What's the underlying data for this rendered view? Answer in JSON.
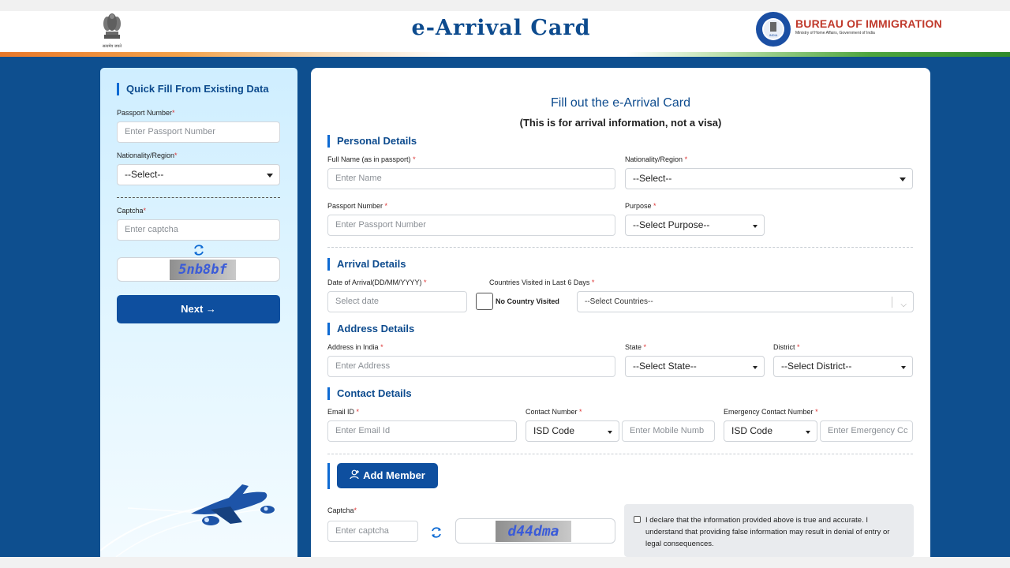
{
  "header": {
    "title": "e-Arrival Card",
    "emblem_caption": "सत्यमेव जयते",
    "bureau_name": "BUREAU OF IMMIGRATION",
    "bureau_sub": "Ministry of Home Affairs, Government of India",
    "bureau_seal_text": "INDIA"
  },
  "sidebar": {
    "title": "Quick Fill From Existing Data",
    "passport_label": "Passport Number",
    "passport_placeholder": "Enter Passport Number",
    "nationality_label": "Nationality/Region",
    "nationality_value": "--Select--",
    "captcha_label": "Captcha",
    "captcha_placeholder": "Enter captcha",
    "captcha_code": "5nb8bf",
    "next_label": "Next →",
    "required_mark": "*"
  },
  "form": {
    "heading": "Fill out the e-Arrival Card",
    "subheading": "(This is for arrival information, not a visa)",
    "required_mark": "*",
    "personal": {
      "title": "Personal Details",
      "full_name_label": "Full Name (as in passport)",
      "full_name_placeholder": "Enter Name",
      "nationality_label": "Nationality/Region",
      "nationality_value": "--Select--",
      "passport_label": "Passport Number",
      "passport_placeholder": "Enter Passport Number",
      "purpose_label": "Purpose",
      "purpose_value": "--Select Purpose--"
    },
    "arrival": {
      "title": "Arrival Details",
      "date_label": "Date of Arrival(DD/MM/YYYY)",
      "date_placeholder": "Select date",
      "countries_label": "Countries Visited in Last 6 Days",
      "no_country_label": "No Country Visited",
      "countries_value": "--Select Countries--"
    },
    "address": {
      "title": "Address Details",
      "address_label": "Address in India",
      "address_placeholder": "Enter Address",
      "state_label": "State",
      "state_value": "--Select State--",
      "district_label": "District",
      "district_value": "--Select District--"
    },
    "contact": {
      "title": "Contact Details",
      "email_label": "Email ID",
      "email_placeholder": "Enter Email Id",
      "contact_label": "Contact Number",
      "isd_value": "ISD Code",
      "mobile_placeholder": "Enter Mobile Numb",
      "emergency_label": "Emergency Contact Number",
      "emergency_isd_value": "ISD Code",
      "emergency_placeholder": "Enter Emergency Cc"
    },
    "add_member_label": "Add Member",
    "captcha": {
      "label": "Captcha",
      "placeholder": "Enter captcha",
      "code": "d44dma"
    },
    "declaration": "I declare that the information provided above is true and accurate. I understand that providing false information may result in denial of entry or legal consequences."
  },
  "colors": {
    "brand_blue": "#0e4f8f",
    "button_blue": "#0e4f9f",
    "accent_red": "#c0392b"
  }
}
